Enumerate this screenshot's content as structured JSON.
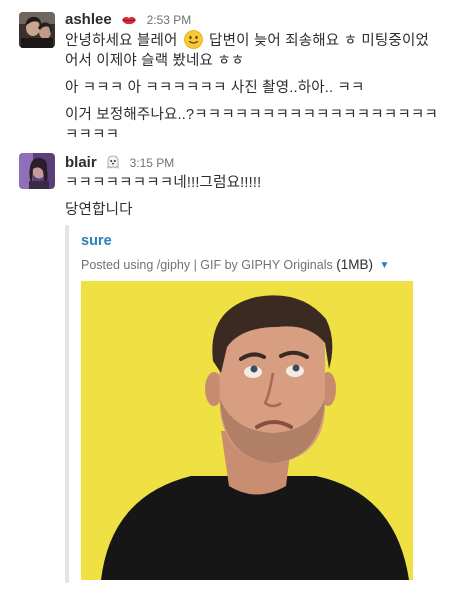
{
  "messages": [
    {
      "sender": "ashlee",
      "status_icon": "lips-emoji-icon",
      "time": "2:53 PM",
      "lines": [
        {
          "before": "안녕하세요 블레어",
          "emoji": "slightly-smiling-face-icon",
          "after": "답변이 늦어 죄송해요 ㅎ 미팅중이었"
        },
        {
          "text": "어서 이제야 슬랙 봤네요 ㅎㅎ"
        },
        {
          "text": "아 ㅋㅋㅋ 아 ㅋㅋㅋㅋㅋㅋ 사진 촬영..하아.. ㅋㅋ"
        },
        {
          "text": "이거 보정해주나요..?ㅋㅋㅋㅋㅋㅋㅋㅋㅋㅋㅋㅋㅋㅋㅋㅋㅋㅋ"
        },
        {
          "text": "ㅋㅋㅋㅋ"
        }
      ]
    },
    {
      "sender": "blair",
      "status_icon": "ghost-emoji-icon",
      "time": "3:15 PM",
      "lines": [
        {
          "text": "ㅋㅋㅋㅋㅋㅋㅋㅋ네!!!그럼요!!!!!"
        },
        {
          "text": "당연합니다"
        }
      ],
      "attachment": {
        "title": "sure",
        "meta": "Posted using /giphy | GIF by GIPHY Originals",
        "size": "(1MB)",
        "caret_icon": "caret-down-icon",
        "image": "giphy-gif-image",
        "bar_color": "#e3e4e6",
        "background_color": "#efe143"
      }
    }
  ]
}
